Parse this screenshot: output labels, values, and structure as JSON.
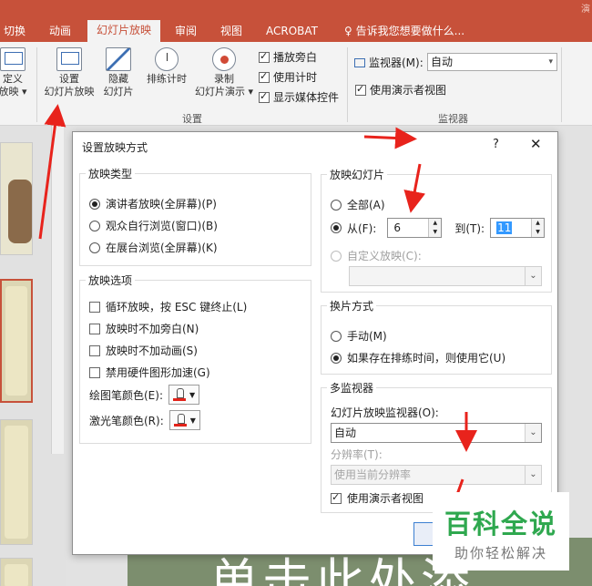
{
  "ribbon_tabs": {
    "corner_text": "演",
    "items": [
      "切换",
      "动画",
      "幻灯片放映",
      "审阅",
      "视图",
      "ACROBAT"
    ],
    "tell_me": "告诉我您想要做什么..."
  },
  "ribbon": {
    "partial_custom_top": "定义",
    "partial_custom_bottom": "放映",
    "setup_show_line1": "设置",
    "setup_show_line2": "幻灯片放映",
    "hide_slide_line1": "隐藏",
    "hide_slide_line2": "幻灯片",
    "rehearse": "排练计时",
    "record_line1": "录制",
    "record_line2": "幻灯片演示",
    "play_narrations": "播放旁白",
    "use_timings": "使用计时",
    "show_media_controls": "显示媒体控件",
    "setup_group_label": "设置",
    "monitor_label": "监视器(M):",
    "monitor_value": "自动",
    "use_presenter_view": "使用演示者视图",
    "monitors_group_label": "监视器"
  },
  "dialog": {
    "title": "设置放映方式",
    "help": "?",
    "close": "✕",
    "show_type": {
      "legend": "放映类型",
      "options": [
        {
          "label": "演讲者放映(全屏幕)(P)",
          "selected": true
        },
        {
          "label": "观众自行浏览(窗口)(B)",
          "selected": false
        },
        {
          "label": "在展台浏览(全屏幕)(K)",
          "selected": false
        }
      ]
    },
    "show_options": {
      "legend": "放映选项",
      "checks": [
        {
          "label": "循环放映，按 ESC 键终止(L)",
          "checked": false
        },
        {
          "label": "放映时不加旁白(N)",
          "checked": false
        },
        {
          "label": "放映时不加动画(S)",
          "checked": false
        },
        {
          "label": "禁用硬件图形加速(G)",
          "checked": false
        }
      ],
      "pen_color_label": "绘图笔颜色(E):",
      "laser_color_label": "激光笔颜色(R):"
    },
    "show_slides": {
      "legend": "放映幻灯片",
      "all_label": "全部(A)",
      "from_label": "从(F):",
      "from_value": "6",
      "to_label": "到(T):",
      "to_value": "11",
      "custom_label": "自定义放映(C):"
    },
    "advance": {
      "legend": "换片方式",
      "manual": "手动(M)",
      "timings": "如果存在排练时间，则使用它(U)"
    },
    "multi_monitor": {
      "legend": "多监视器",
      "monitor_label": "幻灯片放映监视器(O):",
      "monitor_value": "自动",
      "resolution_label": "分辨率(T):",
      "resolution_value": "使用当前分辨率",
      "presenter_view": "使用演示者视图"
    }
  },
  "watermark": {
    "title": "百科全说",
    "subtitle": "助你轻松解决"
  },
  "slide_text": "单击此处添"
}
